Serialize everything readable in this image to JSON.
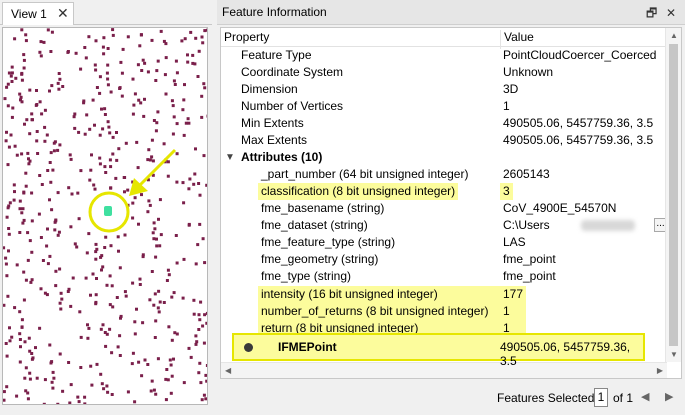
{
  "view": {
    "tab_label": "View 1",
    "close_glyph": "✕"
  },
  "info": {
    "title": "Feature Information",
    "restore_glyph": "🗗",
    "close_glyph": "✕",
    "col_property": "Property",
    "col_value": "Value",
    "rows": [
      {
        "p": "Feature Type",
        "v": "PointCloudCoercer_Coerced"
      },
      {
        "p": "Coordinate System",
        "v": "Unknown"
      },
      {
        "p": "Dimension",
        "v": "3D"
      },
      {
        "p": "Number of Vertices",
        "v": "1"
      },
      {
        "p": "Min Extents",
        "v": "490505.06, 5457759.36, 3.5"
      },
      {
        "p": "Max Extents",
        "v": "490505.06, 5457759.36, 3.5"
      }
    ],
    "attributes_label": "Attributes (10)",
    "attributes": [
      {
        "p": "_part_number (64 bit unsigned integer)",
        "v": "2605143"
      },
      {
        "p": "classification (8 bit unsigned integer)",
        "v": "3"
      },
      {
        "p": "fme_basename (string)",
        "v": "CoV_4900E_54570N"
      },
      {
        "p": "fme_dataset (string)",
        "v": "C:\\Users"
      },
      {
        "p": "fme_feature_type (string)",
        "v": "LAS"
      },
      {
        "p": "fme_geometry (string)",
        "v": "fme_point"
      },
      {
        "p": "fme_type (string)",
        "v": "fme_point"
      },
      {
        "p": "intensity (16 bit unsigned integer)",
        "v": "177"
      },
      {
        "p": "number_of_returns (8 bit unsigned integer)",
        "v": "1"
      },
      {
        "p": "return (8 bit unsigned integer)",
        "v": "1"
      }
    ],
    "ellipsis": "...",
    "geometry_label": "IFMEPoint",
    "geometry_value": "490505.06, 5457759.36, 3.5"
  },
  "status": {
    "features_selected_label": "Features Selected:",
    "selected_value": "1",
    "of_total": "of 1"
  },
  "colors": {
    "point": "#7a1f4a",
    "highlight": "#fcfc9c",
    "callout": "#e6e600",
    "selected_point": "#3fe0a0"
  }
}
